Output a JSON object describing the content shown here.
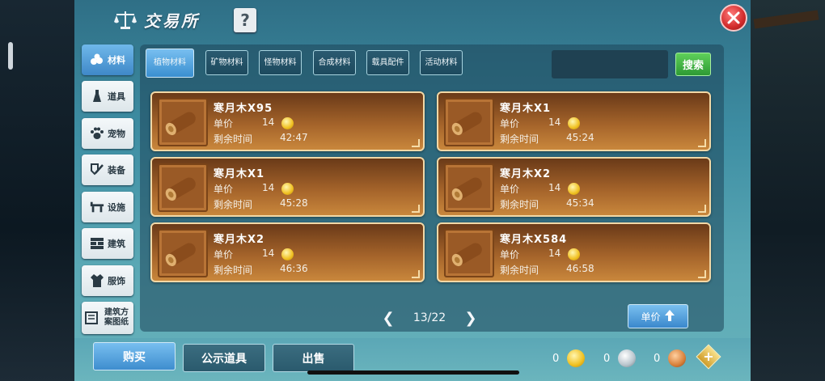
{
  "header": {
    "title": "交易所",
    "help_label": "?"
  },
  "sidebar": {
    "items": [
      {
        "label": "材料",
        "icon": "materials-icon",
        "active": true
      },
      {
        "label": "道具",
        "icon": "potion-icon"
      },
      {
        "label": "宠物",
        "icon": "paw-icon"
      },
      {
        "label": "装备",
        "icon": "equipment-icon"
      },
      {
        "label": "设施",
        "icon": "facility-icon"
      },
      {
        "label": "建筑",
        "icon": "brick-icon"
      },
      {
        "label": "服饰",
        "icon": "clothing-icon"
      },
      {
        "label": "建筑方案图纸",
        "icon": "blueprint-icon"
      }
    ]
  },
  "tabs": [
    {
      "label": "植物材料",
      "active": true
    },
    {
      "label": "矿物材料"
    },
    {
      "label": "怪物材料"
    },
    {
      "label": "合成材料"
    },
    {
      "label": "载具配件"
    },
    {
      "label": "活动材料"
    }
  ],
  "search": {
    "placeholder": "",
    "button_label": "搜索"
  },
  "listing_labels": {
    "price": "单价",
    "time_left": "剩余时间"
  },
  "listings": [
    {
      "name": "寒月木X95",
      "price": "14",
      "time": "42:47"
    },
    {
      "name": "寒月木X1",
      "price": "14",
      "time": "45:24"
    },
    {
      "name": "寒月木X1",
      "price": "14",
      "time": "45:28"
    },
    {
      "name": "寒月木X2",
      "price": "14",
      "time": "45:34"
    },
    {
      "name": "寒月木X2",
      "price": "14",
      "time": "46:36"
    },
    {
      "name": "寒月木X584",
      "price": "14",
      "time": "46:58"
    }
  ],
  "pager": {
    "text": "13/22"
  },
  "sort": {
    "label": "单价"
  },
  "bottom": {
    "buy": "购买",
    "public": "公示道具",
    "sell": "出售"
  },
  "currencies": [
    {
      "amount": "0",
      "type": "gold-coin-icon",
      "color": "#f0c020"
    },
    {
      "amount": "0",
      "type": "silver-coin-icon",
      "color": "#b8c4cc"
    },
    {
      "amount": "0",
      "type": "copper-coin-icon",
      "color": "#d8803a"
    }
  ]
}
